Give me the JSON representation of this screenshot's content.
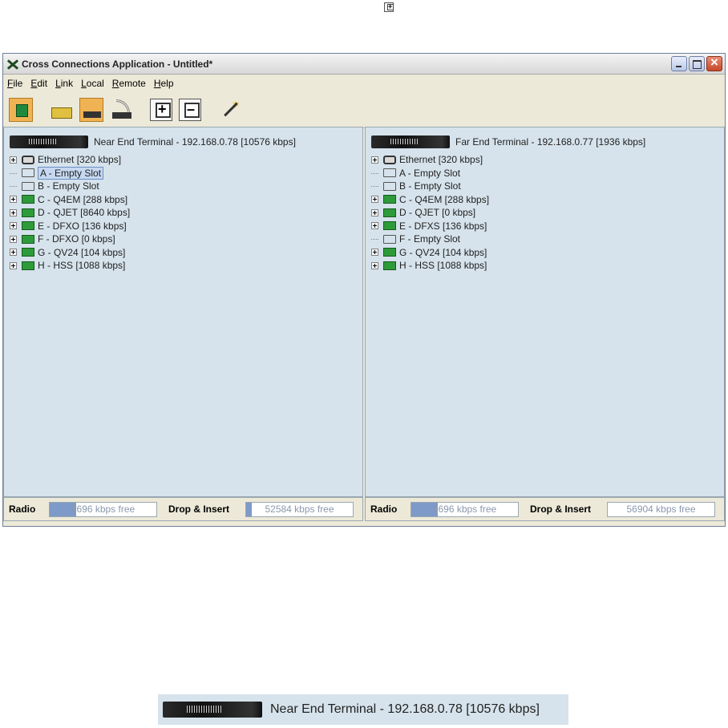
{
  "window": {
    "title": "Cross Connections Application - Untitled*"
  },
  "menu": [
    {
      "mnemonic": "F",
      "rest": "ile"
    },
    {
      "mnemonic": "E",
      "rest": "dit"
    },
    {
      "mnemonic": "L",
      "rest": "ink"
    },
    {
      "mnemonic": "L",
      "rest": "ocal"
    },
    {
      "mnemonic": "R",
      "rest": "emote"
    },
    {
      "mnemonic": "H",
      "rest": "elp"
    }
  ],
  "near": {
    "title": "Near End Terminal - 192.168.0.78 [10576 kbps]",
    "nodes": [
      {
        "label": "Ethernet [320 kbps]",
        "icon": "ethernet-icon",
        "expandable": true
      },
      {
        "label": "A - Empty Slot",
        "icon": "empty-slot-icon",
        "expandable": false,
        "selected": true
      },
      {
        "label": "B - Empty Slot",
        "icon": "empty-slot-icon",
        "expandable": false
      },
      {
        "label": "C - Q4EM [288 kbps]",
        "icon": "card-icon",
        "expandable": true
      },
      {
        "label": "D - QJET [8640 kbps]",
        "icon": "card-icon",
        "expandable": true
      },
      {
        "label": "E - DFXO [136 kbps]",
        "icon": "card-icon",
        "expandable": true
      },
      {
        "label": "F - DFXO [0 kbps]",
        "icon": "card-icon",
        "expandable": true
      },
      {
        "label": "G - QV24 [104 kbps]",
        "icon": "card-icon",
        "expandable": true
      },
      {
        "label": "H - HSS [1088 kbps]",
        "icon": "card-icon",
        "expandable": true
      }
    ],
    "status": {
      "radio_label": "Radio",
      "radio_value": "8696 kbps free",
      "radio_fill": 0.25,
      "di_label": "Drop & Insert",
      "di_value": "52584 kbps free",
      "di_fill": 0.05
    }
  },
  "far": {
    "title": "Far End Terminal - 192.168.0.77 [1936 kbps]",
    "nodes": [
      {
        "label": "Ethernet [320 kbps]",
        "icon": "ethernet-icon",
        "expandable": true
      },
      {
        "label": "A - Empty Slot",
        "icon": "empty-slot-icon",
        "expandable": false
      },
      {
        "label": "B - Empty Slot",
        "icon": "empty-slot-icon",
        "expandable": false
      },
      {
        "label": "C - Q4EM [288 kbps]",
        "icon": "card-icon",
        "expandable": true
      },
      {
        "label": "D - QJET [0 kbps]",
        "icon": "card-icon",
        "expandable": true
      },
      {
        "label": "E - DFXS [136 kbps]",
        "icon": "card-icon",
        "expandable": true
      },
      {
        "label": "F - Empty Slot",
        "icon": "empty-slot-icon",
        "expandable": false
      },
      {
        "label": "G - QV24 [104 kbps]",
        "icon": "card-icon",
        "expandable": true
      },
      {
        "label": "H - HSS [1088 kbps]",
        "icon": "card-icon",
        "expandable": true
      }
    ],
    "status": {
      "radio_label": "Radio",
      "radio_value": "8696 kbps free",
      "radio_fill": 0.25,
      "di_label": "Drop & Insert",
      "di_value": "56904 kbps free",
      "di_fill": 0.0
    }
  },
  "zoom": {
    "title": "Near End Terminal - 192.168.0.78 [10576 kbps]"
  },
  "colors": {
    "pane_bg": "#d6e3ec",
    "window_bg": "#ece9d8",
    "selection": "#c7d8f1"
  }
}
